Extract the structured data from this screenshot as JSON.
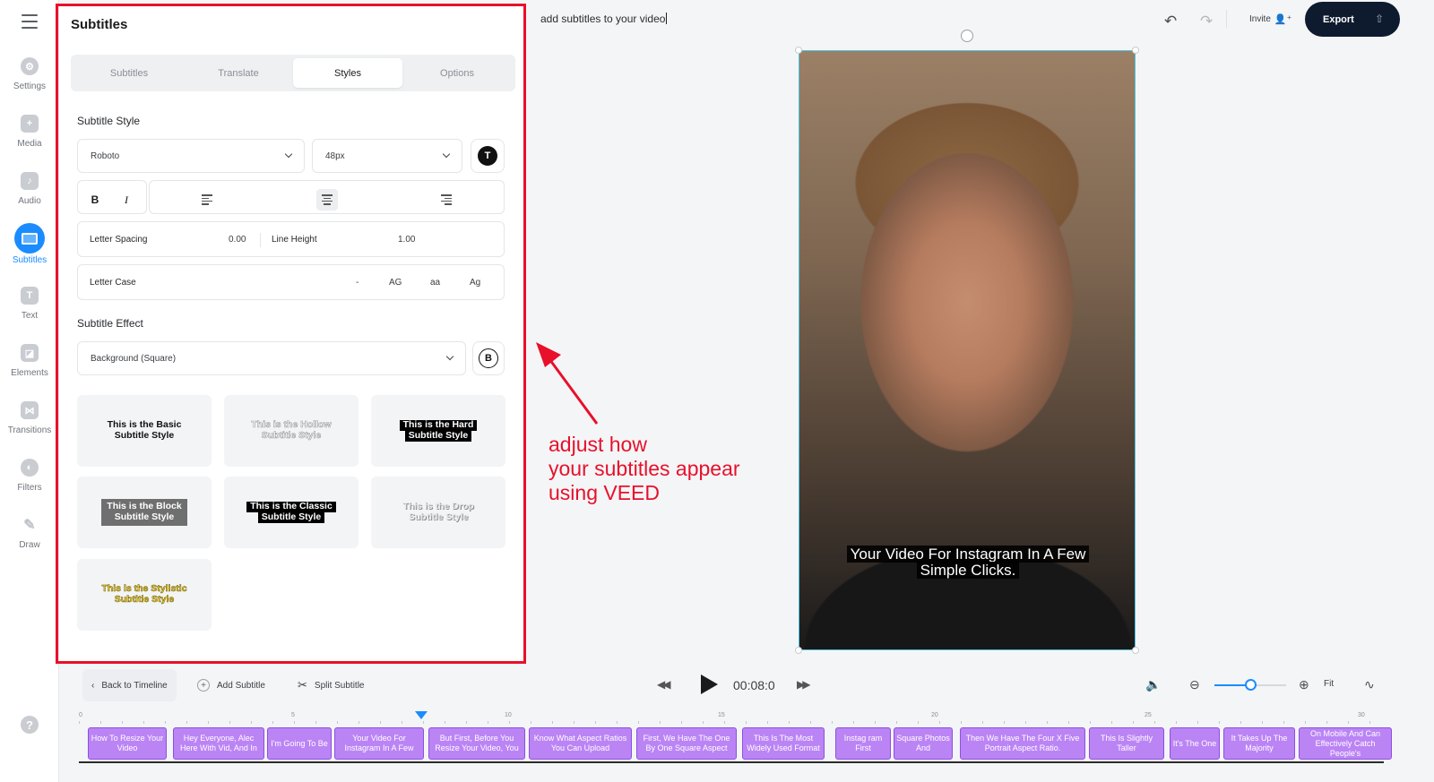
{
  "nav": {
    "items": [
      {
        "label": "Settings",
        "icon": "gear-icon"
      },
      {
        "label": "Media",
        "icon": "plus-icon"
      },
      {
        "label": "Audio",
        "icon": "music-note-icon"
      },
      {
        "label": "Subtitles",
        "icon": "subtitles-icon"
      },
      {
        "label": "Text",
        "icon": "text-icon"
      },
      {
        "label": "Elements",
        "icon": "elements-icon"
      },
      {
        "label": "Transitions",
        "icon": "transitions-icon"
      },
      {
        "label": "Filters",
        "icon": "filters-icon"
      },
      {
        "label": "Draw",
        "icon": "pencil-icon"
      }
    ],
    "active": "Subtitles",
    "help": "?"
  },
  "panel": {
    "title": "Subtitles",
    "tabs": [
      "Subtitles",
      "Translate",
      "Styles",
      "Options"
    ],
    "active_tab": "Styles",
    "subtitle_style_title": "Subtitle Style",
    "font": "Roboto",
    "size": "48px",
    "color_btn": "T",
    "bold": "B",
    "italic": "I",
    "letter_spacing_label": "Letter Spacing",
    "letter_spacing": "0.00",
    "line_height_label": "Line Height",
    "line_height": "1.00",
    "letter_case_label": "Letter Case",
    "letter_case_options": [
      "-",
      "AG",
      "aa",
      "Ag"
    ],
    "effect_title": "Subtitle Effect",
    "effect": "Background (Square)",
    "effect_btn": "B",
    "styles": [
      {
        "l1": "This is the Basic",
        "l2": "Subtitle Style"
      },
      {
        "l1": "This is the Hollow",
        "l2": "Subtitle Style"
      },
      {
        "l1": "This is the Hard",
        "l2": "Subtitle Style"
      },
      {
        "l1": "This is the Block",
        "l2": "Subtitle Style"
      },
      {
        "l1": "This is the Classic",
        "l2": "Subtitle Style"
      },
      {
        "l1": "This is the Drop",
        "l2": "Subtitle Style"
      },
      {
        "l1": "This is the Stylistic",
        "l2": "Subtitle Style"
      }
    ]
  },
  "topbar": {
    "project_name": "add subtitles to your video",
    "invite": "Invite",
    "export": "Export"
  },
  "video": {
    "caption_l1": "Your Video For Instagram In A Few",
    "caption_l2": "Simple Clicks."
  },
  "annotation": {
    "l1": "adjust how",
    "l2": "your subtitles appear",
    "l3": "using VEED",
    "color": "#e8102a"
  },
  "controls": {
    "back": "Back to Timeline",
    "add": "Add Subtitle",
    "split": "Split Subtitle",
    "time": "00:08:0",
    "fit": "Fit",
    "zoom_level": 0.5
  },
  "timeline": {
    "ticks": [
      "0",
      "5",
      "10",
      "15",
      "20",
      "25",
      "30"
    ],
    "clips": [
      "How To Resize Your Video",
      "Hey Everyone, Alec Here With Vid, And In",
      "I'm Going To Be",
      "Your Video For Instagram In A Few",
      "But First, Before You Resize Your Video, You",
      "Know What Aspect Ratios You Can Upload",
      "First, We Have The One By One Square Aspect",
      "This Is The Most Widely Used Format",
      "Instag ram First",
      "Square Photos And",
      "Then We Have The Four X Five Portrait Aspect Ratio.",
      "This Is Slightly Taller",
      "It's The One",
      "It Takes Up The Majority",
      "On Mobile And Can Effectively Catch People's"
    ]
  },
  "colors": {
    "accent": "#1a8cff",
    "clip": "#bb84f5",
    "export_bg": "#0e1a2e"
  }
}
